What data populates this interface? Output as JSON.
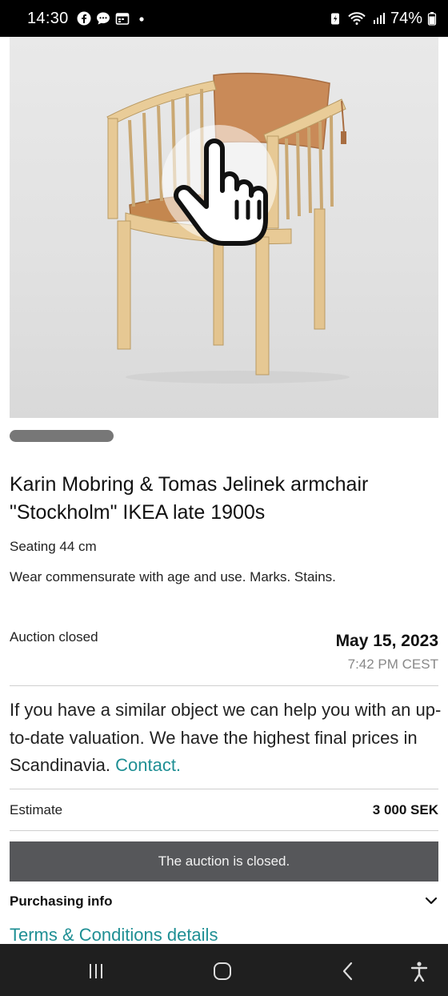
{
  "status_bar": {
    "time": "14:30",
    "left_icons": [
      "facebook-icon",
      "chat-icon",
      "calendar-icon",
      "dot-icon"
    ],
    "battery_percent": "74%",
    "right_icons": [
      "battery-saver-icon",
      "wifi-icon",
      "signal-icon",
      "battery-icon"
    ]
  },
  "listing": {
    "image_alt": "Armchair photo with tap hint",
    "title": "Karin Mobring & Tomas Jelinek armchair \"Stockholm\" IKEA late 1900s",
    "details": [
      "Seating 44 cm",
      "Wear commensurate with age and use. Marks. Stains."
    ]
  },
  "auction": {
    "status": "Auction closed",
    "date": "May 15, 2023",
    "time": "7:42 PM CEST"
  },
  "valuation": {
    "text": "If you have a similar object we can help you with an up-to-date valuation. We have the highest final prices in Scandinavia.",
    "link_label": "Contact."
  },
  "estimate": {
    "label": "Estimate",
    "value": "3 000 SEK"
  },
  "closed_banner": "The auction is closed.",
  "purchasing": {
    "label": "Purchasing info"
  },
  "terms_link": "Terms & Conditions details",
  "nav_bar": {
    "buttons": [
      "recent-apps-icon",
      "home-icon",
      "back-icon",
      "accessibility-icon"
    ]
  }
}
